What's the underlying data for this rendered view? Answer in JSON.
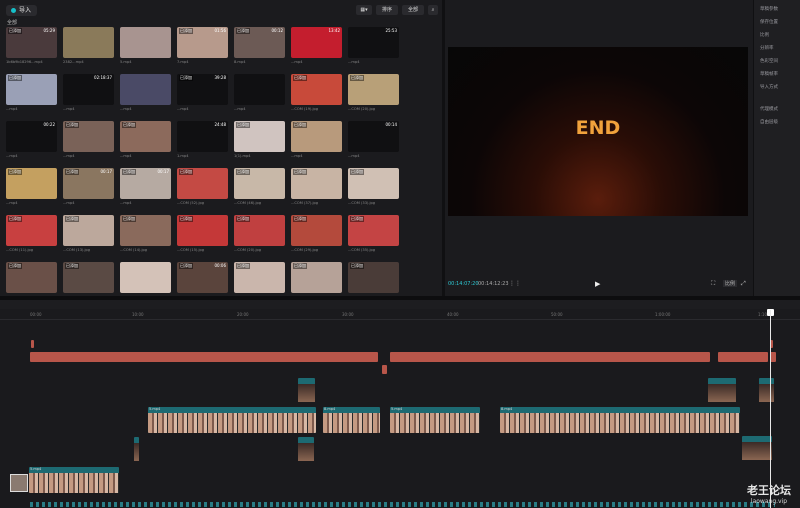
{
  "media": {
    "import_label": "导入",
    "toolbar": {
      "view_label": "排序",
      "filter_label": "全部"
    },
    "all_label": "全部",
    "items": [
      {
        "badge": "已添加",
        "duration": "05:29",
        "name": "1b6b9b18296...mp4",
        "color": "#4a3a3c"
      },
      {
        "badge": "",
        "duration": "",
        "name": "2382...mp4",
        "color": "#8a7a5a"
      },
      {
        "badge": "",
        "duration": "",
        "name": "5.mp4",
        "color": "#a89490"
      },
      {
        "badge": "已添加",
        "duration": "01:56",
        "name": "7.mp4",
        "color": "#b79a8c"
      },
      {
        "badge": "已添加",
        "duration": "00:12",
        "name": "8.mp4",
        "color": "#6c5a55"
      },
      {
        "badge": "",
        "duration": "13:42",
        "name": "...mp4",
        "color": "#c41e2e"
      },
      {
        "badge": "",
        "duration": "25:53",
        "name": "...mp4",
        "color": "#101012"
      },
      {
        "badge": "已添加",
        "duration": "",
        "name": "...mp4",
        "color": "#9aa0b6"
      },
      {
        "badge": "",
        "duration": "02:18:37",
        "name": "...mp4",
        "color": "#101012"
      },
      {
        "badge": "",
        "duration": "",
        "name": "...mp4",
        "color": "#4a4a66"
      },
      {
        "badge": "已添加",
        "duration": "39:28",
        "name": "...mp4",
        "color": "#101012"
      },
      {
        "badge": "",
        "duration": "",
        "name": "...mp4",
        "color": "#101012"
      },
      {
        "badge": "已添加",
        "duration": "",
        "name": "...COM (19).jpg",
        "color": "#c84a3a"
      },
      {
        "badge": "已添加",
        "duration": "",
        "name": "...COM (20).jpg",
        "color": "#b8a078"
      },
      {
        "badge": "",
        "duration": "00:22",
        "name": "...mp4",
        "color": "#101012"
      },
      {
        "badge": "已添加",
        "duration": "",
        "name": "...mp4",
        "color": "#7a6258"
      },
      {
        "badge": "已添加",
        "duration": "",
        "name": "...mp4",
        "color": "#8c6a5c"
      },
      {
        "badge": "",
        "duration": "24:48",
        "name": "1.mp4",
        "color": "#101012"
      },
      {
        "badge": "已添加",
        "duration": "",
        "name": "1(1).mp4",
        "color": "#d0c4c0"
      },
      {
        "badge": "已添加",
        "duration": "",
        "name": "...mp4",
        "color": "#b89a7c"
      },
      {
        "badge": "",
        "duration": "00:14",
        "name": "...mp4",
        "color": "#101012"
      },
      {
        "badge": "已添加",
        "duration": "",
        "name": "...mp4",
        "color": "#c4a060"
      },
      {
        "badge": "已添加",
        "duration": "00:17",
        "name": "...mp4",
        "color": "#8a7660"
      },
      {
        "badge": "已添加",
        "duration": "00:17",
        "name": "...mp4",
        "color": "#b6aaa2"
      },
      {
        "badge": "已添加",
        "duration": "",
        "name": "...COM (52).jpg",
        "color": "#c44a44"
      },
      {
        "badge": "已添加",
        "duration": "",
        "name": "...COM (46).jpg",
        "color": "#c8b8a8"
      },
      {
        "badge": "已添加",
        "duration": "",
        "name": "...COM (37).jpg",
        "color": "#c8b4a4"
      },
      {
        "badge": "已添加",
        "duration": "",
        "name": "...COM (33).jpg",
        "color": "#d0c0b4"
      },
      {
        "badge": "已添加",
        "duration": "",
        "name": "...COM (11).jpg",
        "color": "#c84040"
      },
      {
        "badge": "已添加",
        "duration": "",
        "name": "...COM (13).jpg",
        "color": "#bca89c"
      },
      {
        "badge": "已添加",
        "duration": "",
        "name": "...COM (14).jpg",
        "color": "#8a6a5c"
      },
      {
        "badge": "已添加",
        "duration": "",
        "name": "...COM (15).jpg",
        "color": "#c43838"
      },
      {
        "badge": "已添加",
        "duration": "",
        "name": "...COM (20).jpg",
        "color": "#c04040"
      },
      {
        "badge": "已添加",
        "duration": "",
        "name": "...COM (29).jpg",
        "color": "#b44a3c"
      },
      {
        "badge": "已添加",
        "duration": "",
        "name": "...COM (35).jpg",
        "color": "#c44444"
      },
      {
        "badge": "已添加",
        "duration": "",
        "name": "...mp4",
        "color": "#6a5048"
      },
      {
        "badge": "已添加",
        "duration": "",
        "name": "...mp4",
        "color": "#5a4a44"
      },
      {
        "badge": "",
        "duration": "",
        "name": "...mp4",
        "color": "#d4c2b8"
      },
      {
        "badge": "已添加",
        "duration": "00:06",
        "name": "...mp4",
        "color": "#5a443c"
      },
      {
        "badge": "已添加",
        "duration": "",
        "name": "...mp4",
        "color": "#cab6ac"
      },
      {
        "badge": "已添加",
        "duration": "",
        "name": "...mp4",
        "color": "#b6a298"
      },
      {
        "badge": "已添加",
        "duration": "",
        "name": "...mp4",
        "color": "#4a3c38"
      }
    ]
  },
  "player": {
    "video_text": "END",
    "time_current": "00:14:07:20",
    "time_total": "00:14:12:23",
    "play_icon": "▶",
    "ratio_label": "比例",
    "fullscreen_icon": "⤢"
  },
  "right_panel": {
    "items": [
      "草稿参数",
      "保存位置",
      "比例",
      "分辨率",
      "色彩空间",
      "草稿帧率",
      "导入方式",
      "代理模式",
      "自由层级"
    ]
  },
  "timeline": {
    "ruler_ticks": [
      "00:00",
      "10:00",
      "20:00",
      "30:00",
      "40:00",
      "50:00",
      "1:00:00",
      "1:10:00"
    ],
    "clip_labels": [
      "5.mp4",
      "8.mp4",
      "5.mp4",
      "8.mp4",
      "5.mp4",
      "8.mp4"
    ]
  },
  "watermark": {
    "main": "老王论坛",
    "sub": "laowang.vip"
  },
  "colors": {
    "accent": "#2ec8d3",
    "audio_clip": "#b8564a",
    "video_clip": "#1d6a72"
  }
}
